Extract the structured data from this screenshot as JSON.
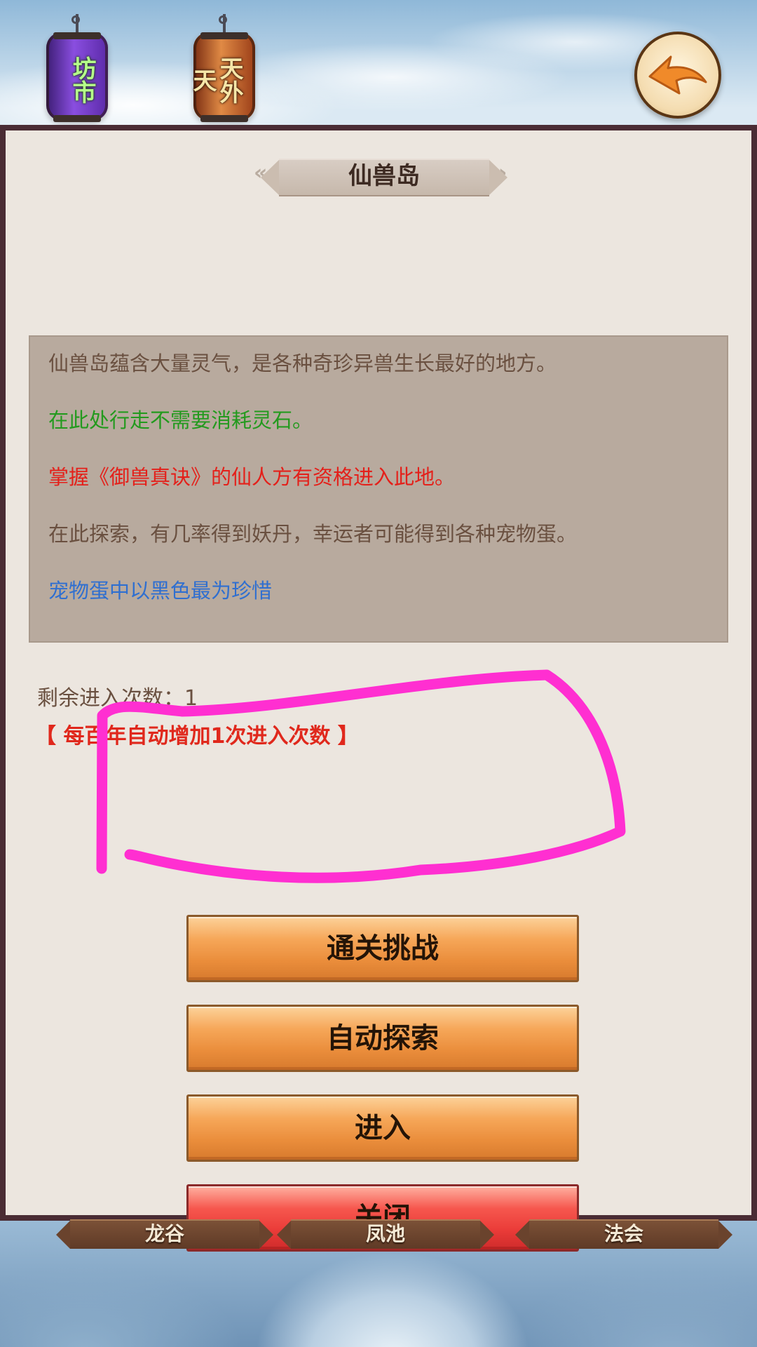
{
  "top_bar": {
    "lanterns": [
      {
        "label": "坊市",
        "icon": "purple-lantern-icon"
      },
      {
        "label": "天外天",
        "icon": "orange-lantern-icon"
      }
    ],
    "back_icon": "back-arrow-icon"
  },
  "panel": {
    "title": "仙兽岛",
    "description": [
      {
        "text": "仙兽岛蕴含大量灵气，是各种奇珍异兽生长最好的地方。",
        "color": "#6a5040"
      },
      {
        "text": "在此处行走不需要消耗灵石。",
        "color": "#239a1e"
      },
      {
        "text": "掌握《御兽真诀》的仙人方有资格进入此地。",
        "color": "#e4201a"
      },
      {
        "text": "在此探索，有几率得到妖丹，幸运者可能得到各种宠物蛋。",
        "color": "#6a5040"
      },
      {
        "text": "宠物蛋中以黑色最为珍惜",
        "color": "#2f6fd0"
      }
    ],
    "remaining_label": "剩余进入次数：1",
    "remaining_note": "【 每百年自动增加1次进入次数 】"
  },
  "buttons": {
    "challenge": "通关挑战",
    "auto_explore": "自动探索",
    "enter": "进入",
    "close": "关闭"
  },
  "bottom_locations": [
    "龙谷",
    "凤池",
    "法会"
  ],
  "colors": {
    "panel_border": "#4a2c34",
    "panel_bg": "#ece6df",
    "button_orange": "#f0963f",
    "button_red": "#ea3b38",
    "annotation": "#ff2fd1"
  }
}
